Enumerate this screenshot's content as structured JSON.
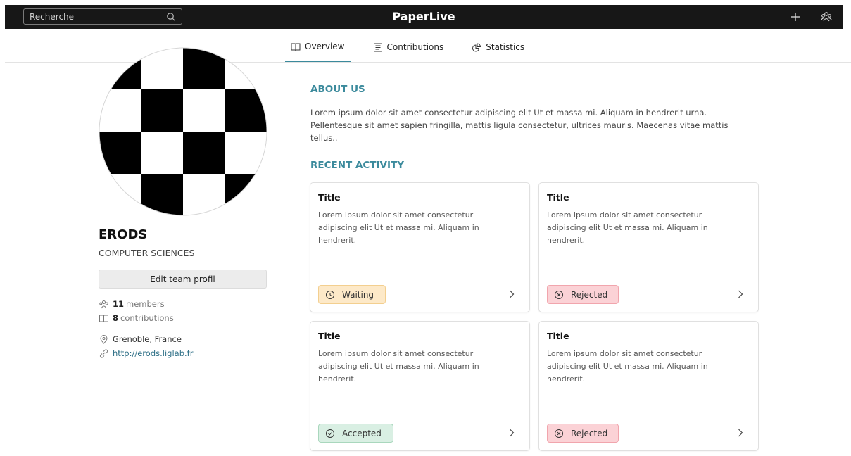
{
  "header": {
    "search_placeholder": "Recherche",
    "brand": "PaperLive"
  },
  "tabs": [
    {
      "label": "Overview"
    },
    {
      "label": "Contributions"
    },
    {
      "label": "Statistics"
    }
  ],
  "profile": {
    "name": "ERODS",
    "department": "COMPUTER SCIENCES",
    "edit_label": "Edit team profil",
    "members_count": "11",
    "members_label": "members",
    "contributions_count": "8",
    "contributions_label": "contributions",
    "location": "Grenoble, France",
    "website": "http://erods.liglab.fr"
  },
  "about": {
    "title": "ABOUT US",
    "text": "Lorem ipsum dolor sit amet consectetur adipiscing elit Ut et massa mi. Aliquam in hendrerit urna. Pellentesque sit amet sapien fringilla, mattis ligula consectetur, ultrices mauris. Maecenas vitae mattis tellus.."
  },
  "activity": {
    "title": "RECENT ACTIVITY",
    "cards": [
      {
        "title": "Title",
        "text": "Lorem ipsum dolor sit amet consectetur adipiscing elit Ut et massa mi. Aliquam in hendrerit.",
        "status": "Waiting"
      },
      {
        "title": "Title",
        "text": "Lorem ipsum dolor sit amet consectetur adipiscing elit Ut et massa mi. Aliquam in hendrerit.",
        "status": "Rejected"
      },
      {
        "title": "Title",
        "text": "Lorem ipsum dolor sit amet consectetur adipiscing elit Ut et massa mi. Aliquam in hendrerit.",
        "status": "Accepted"
      },
      {
        "title": "Title",
        "text": "Lorem ipsum dolor sit amet consectetur adipiscing elit Ut et massa mi. Aliquam in hendrerit.",
        "status": "Rejected"
      }
    ]
  },
  "colors": {
    "topbar": "#171717",
    "accent": "#3b8a9c",
    "waiting_bg": "#fde9c8",
    "rejected_bg": "#fbd2d6",
    "accepted_bg": "#d9efe3"
  }
}
